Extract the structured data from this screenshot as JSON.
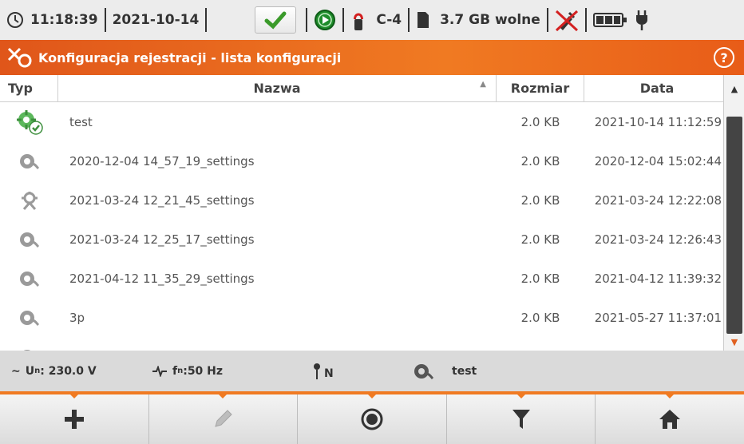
{
  "status": {
    "time": "11:18:39",
    "date": "2021-10-14",
    "clamp": "C-4",
    "free_space": "3.7 GB wolne"
  },
  "title": "Konfiguracja rejestracji - lista konfiguracji",
  "help_glyph": "?",
  "table": {
    "columns": [
      "Typ",
      "Nazwa",
      "Rozmiar",
      "Data"
    ],
    "rows": [
      {
        "icon": "active-config-icon",
        "name": "test",
        "size": "2.0 KB",
        "date": "2021-10-14 11:12:59"
      },
      {
        "icon": "config-icon",
        "name": "2020-12-04 14_57_19_settings",
        "size": "2.0 KB",
        "date": "2020-12-04 15:02:44"
      },
      {
        "icon": "network-config-icon",
        "name": "2021-03-24 12_21_45_settings",
        "size": "2.0 KB",
        "date": "2021-03-24 12:22:08"
      },
      {
        "icon": "config-icon",
        "name": "2021-03-24 12_25_17_settings",
        "size": "2.0 KB",
        "date": "2021-03-24 12:26:43"
      },
      {
        "icon": "config-icon",
        "name": "2021-04-12 11_35_29_settings",
        "size": "2.0 KB",
        "date": "2021-04-12 11:39:32"
      },
      {
        "icon": "config-icon",
        "name": "3p",
        "size": "2.0 KB",
        "date": "2021-05-27 11:37:01"
      }
    ]
  },
  "info": {
    "un_label": "U",
    "un_sub": "n",
    "un_value": ": 230.0 V",
    "fn_label": "f",
    "fn_sub": "n",
    "fn_value": ":50 Hz",
    "network": "N",
    "config": "test"
  },
  "colors": {
    "accent": "#f07a22",
    "active_green": "#5cb85c"
  }
}
